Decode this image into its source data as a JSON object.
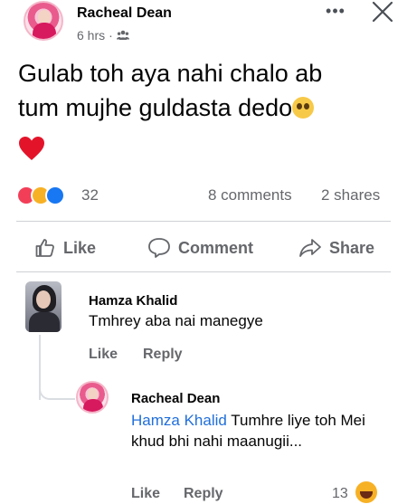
{
  "post": {
    "author": "Racheal Dean",
    "time": "6 hrs",
    "separator": "·",
    "more_label": "•••",
    "text_line1": "Gulab toh aya nahi chalo ab",
    "text_line2": "tum mujhe guldasta dedo",
    "reaction_count": "32",
    "comments_count": "8 comments",
    "shares_count": "2 shares",
    "reactions": [
      "love",
      "haha",
      "like"
    ]
  },
  "actions": {
    "like": "Like",
    "comment": "Comment",
    "share": "Share"
  },
  "comments": [
    {
      "author": "Hamza Khalid",
      "text": "Tmhrey aba nai manegye",
      "like": "Like",
      "reply": "Reply"
    },
    {
      "author": "Racheal Dean",
      "mention": "Hamza Khalid",
      "text": " Tumhre liye toh Mei khud bhi nahi maanugii...",
      "like": "Like",
      "reply": "Reply",
      "reaction_count": "13"
    }
  ],
  "colors": {
    "text": "#050505",
    "secondary": "#65676b",
    "link": "#216fdb",
    "like_blue": "#1877f2",
    "love_red": "#f33e58",
    "haha_yellow": "#f7b125"
  },
  "icons": [
    "audience-icon",
    "close-icon",
    "heart-icon",
    "like-icon",
    "comment-icon",
    "share-icon",
    "haha-icon"
  ]
}
